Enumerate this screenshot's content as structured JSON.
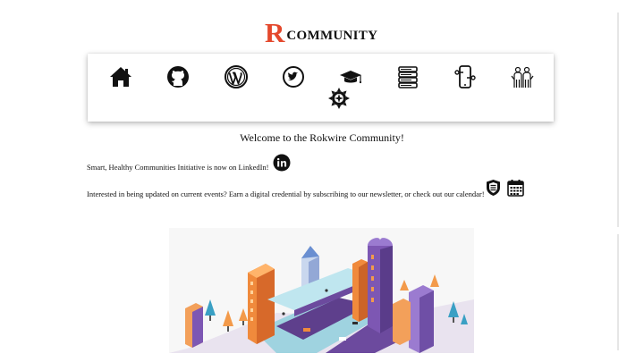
{
  "header": {
    "logo_letter": "R",
    "logo_word": "COMMUNITY",
    "brand_color": "#e4482c"
  },
  "icons": [
    {
      "name": "home-icon"
    },
    {
      "name": "github-icon"
    },
    {
      "name": "wordpress-icon"
    },
    {
      "name": "twitter-icon"
    },
    {
      "name": "graduation-cap-icon"
    },
    {
      "name": "book-stack-icon"
    },
    {
      "name": "mobile-app-icon"
    },
    {
      "name": "community-people-icon"
    },
    {
      "name": "gear-sun-icon"
    }
  ],
  "main": {
    "welcome": "Welcome to the Rokwire Community!",
    "linkedin_text": "Smart, Healthy Communities Initiative is now on LinkedIn!",
    "newsletter_text": "Interested in being updated on current events? Earn a digital credential by subscribing to our newsletter, or check out our calendar!"
  }
}
